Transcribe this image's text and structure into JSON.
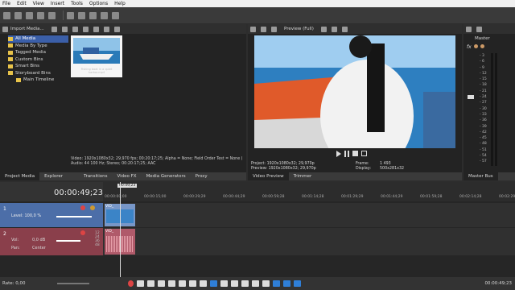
{
  "menu": [
    "File",
    "Edit",
    "View",
    "Insert",
    "Tools",
    "Options",
    "Help"
  ],
  "media_panel": {
    "toolbar_label": "Import Media...",
    "tree": [
      "All Media",
      "Media By Type",
      "Tagged Media",
      "Custom Bins",
      "Smart Bins",
      "Storyboard Bins",
      "Main Timeline"
    ],
    "thumb_caption": "Fishing boat in a quiet harbor.mp4",
    "info_line1": "Video: 1920x1080x32; 29,970 fps; 00:20:17;25; Alpha = None; Field Order Test = None (",
    "info_line2": "Audio: 44 100 Hz; Stereo; 00:20:17;25; AAC"
  },
  "left_tabs": [
    "Project Media",
    "Explorer",
    "Transitions",
    "Video FX",
    "Media Generators",
    "Proxy"
  ],
  "preview": {
    "mode": "Preview (Full)",
    "project_label": "Project:",
    "project_val": "1920x1080x32; 29,970p",
    "preview_label": "Preview:",
    "preview_val": "1920x1080x32; 29,970p",
    "frame_label": "Frame:",
    "frame_val": "1 493",
    "display_label": "Display:",
    "display_val": "500x281x32",
    "tabs": [
      "Video Preview",
      "Trimmer"
    ]
  },
  "master": {
    "title": "Master",
    "scale": [
      "3",
      "6",
      "9",
      "12",
      "15",
      "18",
      "21",
      "24",
      "27",
      "30",
      "33",
      "36",
      "39",
      "42",
      "45",
      "48",
      "51",
      "54",
      "57"
    ],
    "tab": "Master Bus"
  },
  "timeline": {
    "timecode": "00:00:49;23",
    "marker": "00:49;23",
    "ruler": [
      "00:00:00;00",
      "00:00:15;00",
      "00:00:29;29",
      "00:00:44;29",
      "00:00:59;28",
      "00:01:14;28",
      "00:01:29;29",
      "00:01:44;29",
      "00:01:59;28",
      "00:02:14;28",
      "00:02:29;29"
    ],
    "video_track": {
      "num": "1",
      "level": "Level: 100,0 %",
      "clip": "VID_"
    },
    "audio_track": {
      "num": "2",
      "vol_label": "Vol:",
      "vol_val": "0,0 dB",
      "pan_label": "Pan:",
      "pan_val": "Center",
      "clip": "VID_",
      "meter": [
        "12",
        "24",
        "36",
        "48"
      ]
    }
  },
  "status": {
    "rate": "Rate: 0,00",
    "time": "00:00:49;23"
  }
}
